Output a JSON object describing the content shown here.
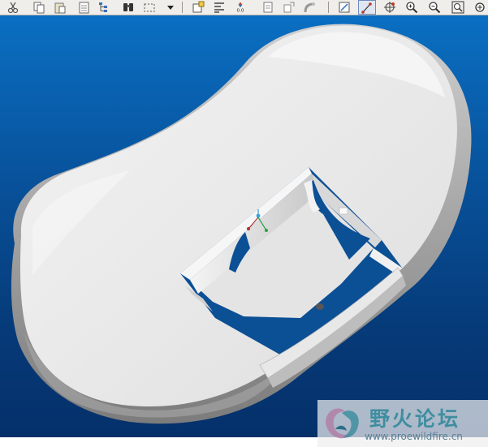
{
  "toolbar": {
    "groups": [
      [
        "cut-icon",
        "copy-icon",
        "paste-icon",
        "paste-special-icon",
        "tree-view-icon",
        "find-icon",
        "selection-box-icon",
        "dropdown-arrow-icon"
      ],
      [
        "new-feature-icon",
        "text-align-icon",
        "dimension-value-icon",
        "note-icon",
        "rename-icon",
        "sweep-icon"
      ],
      [
        "sketch-view-icon",
        "datum-display-icon",
        "spin-center-icon",
        "zoom-in-icon",
        "zoom-out-icon",
        "zoom-fit-icon",
        "refit-icon"
      ]
    ],
    "dimension_value_text": "0.0",
    "pressed_button": "datum-display-icon"
  },
  "viewport": {
    "background_top": "#0a6fc2",
    "background_bottom": "#05306a",
    "model_color": "#e6e6e6"
  },
  "watermark": {
    "title": "野火论坛",
    "url": "www.proewildfire.cn",
    "accent": "#3f8ea0"
  }
}
